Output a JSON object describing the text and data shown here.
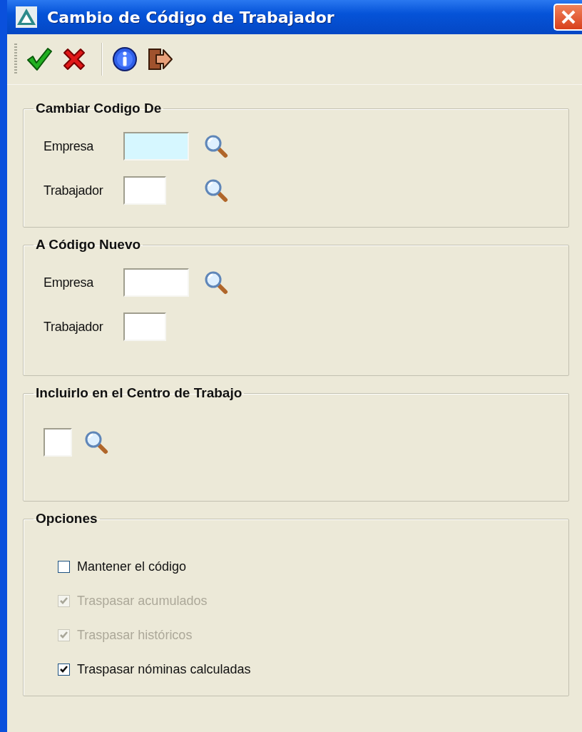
{
  "window": {
    "title": "Cambio de Código de Trabajador"
  },
  "toolbar": {
    "groups": [
      {
        "buttons": [
          {
            "kind": "accept"
          },
          {
            "kind": "cancel"
          }
        ]
      },
      {
        "buttons": [
          {
            "kind": "info"
          },
          {
            "kind": "exit"
          }
        ]
      }
    ]
  },
  "groups": [
    {
      "title": "Cambiar Codigo De",
      "fields": [
        {
          "label": "Empresa",
          "kind": "wide",
          "focused": true,
          "lookup": true
        },
        {
          "label": "Trabajador",
          "kind": "narrow",
          "focused": false,
          "lookup": true
        }
      ]
    },
    {
      "title": "A Código Nuevo",
      "fields": [
        {
          "label": "Empresa",
          "kind": "wide",
          "focused": false,
          "lookup": true
        },
        {
          "label": "Trabajador",
          "kind": "narrow",
          "focused": false,
          "lookup": false
        }
      ]
    },
    {
      "title": "Incluirlo en el Centro de Trabajo",
      "fields": [
        {
          "kind": "short",
          "focused": false,
          "lookup": true
        }
      ]
    },
    {
      "title": "Opciones",
      "options": [
        {
          "label": "Mantener el código",
          "checked": false,
          "disabled": false
        },
        {
          "label": "Traspasar acumulados",
          "checked": true,
          "disabled": true
        },
        {
          "label": "Traspasar históricos",
          "checked": true,
          "disabled": true
        },
        {
          "label": "Traspasar nóminas calculadas",
          "checked": true,
          "disabled": false
        }
      ]
    }
  ]
}
